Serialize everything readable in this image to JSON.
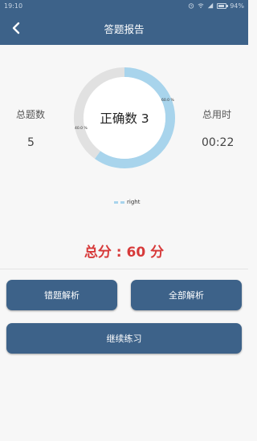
{
  "status_bar": {
    "time": "19:10",
    "battery": "94%",
    "battery_level": 0.94,
    "icons": [
      "alarm-icon",
      "wifi-icon",
      "signal-icon",
      "battery-icon"
    ]
  },
  "header": {
    "title": "答题报告",
    "back_icon": "chevron-left-icon"
  },
  "stats": {
    "total_label": "总题数",
    "total_value": "5",
    "time_label": "总用时",
    "time_value": "00:22"
  },
  "chart_data": {
    "type": "pie",
    "center_text": "正确数 3",
    "slices": [
      {
        "label": "60.0 %",
        "value": 60,
        "color": "#a8d4ec"
      },
      {
        "label": "40.0 %",
        "value": 40,
        "color": "#e1e1e1"
      }
    ],
    "legend": [
      {
        "name": "right",
        "color": "#a8d4ec"
      }
    ]
  },
  "score_text": "总分 : 60 分",
  "buttons": {
    "wrong_analysis": "错题解析",
    "all_analysis": "全部解析",
    "continue_practice": "继续练习"
  },
  "colors": {
    "primary": "#3d6289",
    "score": "#d73a3a",
    "ring_correct": "#a8d4ec",
    "ring_wrong": "#e1e1e1"
  }
}
